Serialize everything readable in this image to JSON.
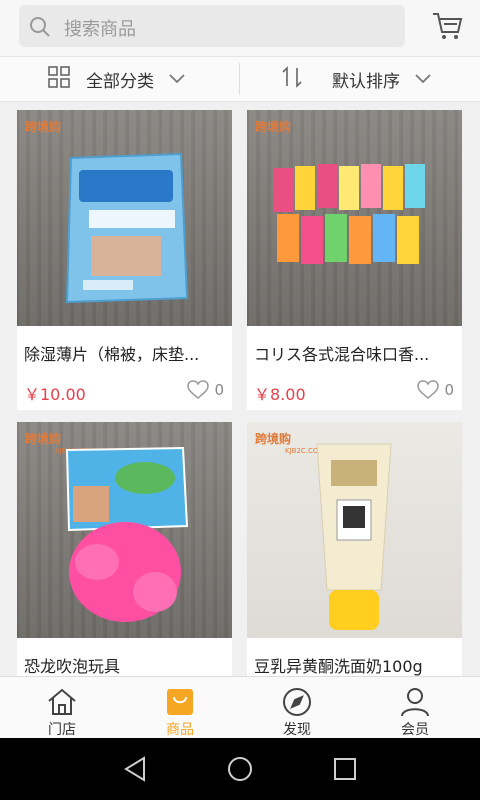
{
  "search": {
    "placeholder": "搜索商品"
  },
  "filters": {
    "category": "全部分类",
    "sort": "默认排序"
  },
  "products": [
    {
      "title": "除湿薄片（棉被，床垫...",
      "price": "￥10.00",
      "likes": "0"
    },
    {
      "title": "コリス各式混合味口香...",
      "price": "￥8.00",
      "likes": "0"
    },
    {
      "title": "恐龙吹泡玩具",
      "price": "",
      "likes": ""
    },
    {
      "title": "豆乳异黄酮洗面奶100g",
      "price": "",
      "likes": ""
    }
  ],
  "watermark": {
    "logo": "跨境购",
    "url": "KJB2C.COM"
  },
  "tabs": [
    {
      "label": "门店",
      "icon": "home-icon"
    },
    {
      "label": "商品",
      "icon": "bag-icon",
      "active": true
    },
    {
      "label": "发现",
      "icon": "compass-icon"
    },
    {
      "label": "会员",
      "icon": "user-icon"
    }
  ],
  "colors": {
    "accent": "#f5a623",
    "price": "#e8404a"
  }
}
